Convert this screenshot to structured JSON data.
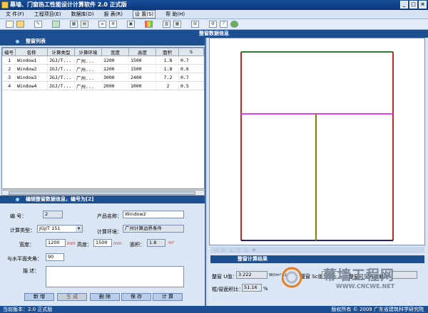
{
  "app": {
    "title": "幕墙、门窗热工性能设计计算软件 2.0 正式版"
  },
  "window_buttons": {
    "minimize": "_",
    "maximize": "□",
    "close": "×"
  },
  "menu": [
    {
      "label": "文 件(F)"
    },
    {
      "label": "工程项目(E)"
    },
    {
      "label": "数据库(D)"
    },
    {
      "label": "报 表(R)"
    },
    {
      "label": "设 置(S)"
    },
    {
      "label": "帮 助(H)"
    }
  ],
  "toolbar_icons": [
    "new-file-icon",
    "open-folder-icon",
    "edit-icon",
    "window-icon",
    "grid-icon",
    "table-icon",
    "list-icon",
    "list-alt-icon",
    "report-icon",
    "color-icon",
    "chart-icon",
    "settings-icon",
    "help-icon",
    "globe-icon"
  ],
  "main_title": "整窗数据信息",
  "window_list": {
    "title": "整窗列表",
    "columns": [
      "编号",
      "名称",
      "计算类型",
      "计算环境",
      "宽度",
      "高度",
      "面积",
      "S"
    ],
    "rows": [
      [
        "1",
        "Window1",
        "JGJ/T...",
        "广州...",
        "1200",
        "1500",
        "1.8",
        "0.7"
      ],
      [
        "2",
        "Window2",
        "JGJ/T...",
        "广州...",
        "1200",
        "1500",
        "1.8",
        "0.6"
      ],
      [
        "3",
        "Window3",
        "JGJ/T...",
        "广州...",
        "3000",
        "2400",
        "7.2",
        "0.7"
      ],
      [
        "4",
        "Window4",
        "JGJ/T...",
        "广州...",
        "2000",
        "1000",
        "2",
        "0.5"
      ]
    ]
  },
  "edit_form": {
    "title": "编辑整窗数据信息，编号为[2]",
    "id_label": "编 号：",
    "id_value": "2",
    "name_label": "产品名称：",
    "name_value": "Window2",
    "calc_type_label": "计算类型：",
    "calc_type_value": "JGJ/T 151",
    "env_label": "计算环境：",
    "env_value": "广州计算边界条件",
    "width_label": "宽度：",
    "width_value": "1200",
    "height_label": "高度：",
    "height_value": "1500",
    "area_label": "面积：",
    "area_value": "1.8",
    "unit_mm": "mm",
    "unit_m2": "m²",
    "angle_label": "与水平面夹角：",
    "angle_value": "90",
    "desc_label": "描 述：",
    "desc_value": "",
    "buttons": [
      "新 增",
      "生 成",
      "删 除",
      "保 存",
      "计 算"
    ]
  },
  "results": {
    "title": "整窗计算结果",
    "u_label": "整窗 U值：",
    "u_value": "3.222",
    "u_unit": "W/(m²·K)",
    "sc_label": "整窗 Sc值：",
    "sc_value": "0.60",
    "vt_label": "整窗可见光透射比：",
    "vt_value": "",
    "ratio_label": "框/窗面积比：",
    "ratio_value": "51.16",
    "ratio_unit": "%"
  },
  "watermark": {
    "brand": "幕墙工程网",
    "url": "WWW.CNCWE.NET",
    "logo_text": "cwe"
  },
  "status": {
    "version": "当前版本：2.0 正式版",
    "copyright": "版权所有 © 2009 广东省建筑科学研究院"
  },
  "colors": {
    "frame_outer_top": "#2e7d32",
    "frame_outer_side": "#c62828",
    "frame_outer_bottom": "#1a237e",
    "transom": "#e040fb",
    "mullion": "#808000"
  }
}
